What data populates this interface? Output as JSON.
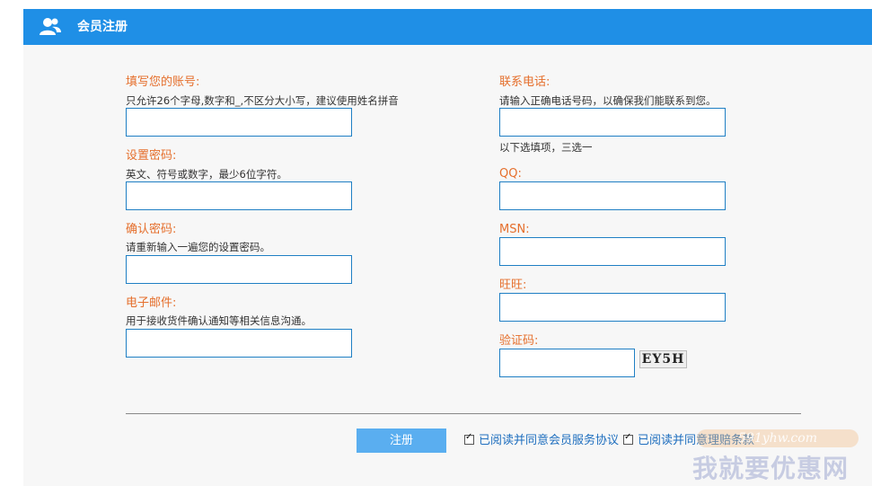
{
  "header": {
    "title": "会员注册",
    "icon": "users-icon"
  },
  "left_fields": [
    {
      "label": "填写您的账号:",
      "hint": "只允许26个字母,数字和_,不区分大小写，建议使用姓名拼音",
      "value": ""
    },
    {
      "label": "设置密码:",
      "hint": "英文、符号或数字，最少6位字符。",
      "value": ""
    },
    {
      "label": "确认密码:",
      "hint": "请重新输入一遍您的设置密码。",
      "value": ""
    },
    {
      "label": "电子邮件:",
      "hint": "用于接收货件确认通知等相关信息沟通。",
      "value": ""
    }
  ],
  "right_fields": {
    "phone": {
      "label": "联系电话:",
      "hint": "请输入正确电话号码，以确保我们能联系到您。",
      "value": ""
    },
    "optional_note": "以下选填项，三选一",
    "qq": {
      "label": "QQ:",
      "value": ""
    },
    "msn": {
      "label": "MSN:",
      "value": ""
    },
    "wangwang": {
      "label": "旺旺:",
      "value": ""
    },
    "captcha": {
      "label": "验证码:",
      "value": "",
      "image_text": "EY5H"
    }
  },
  "footer": {
    "submit_label": "注册",
    "agree_service": "已阅读并同意会员服务协议",
    "agree_claims": "已阅读并同意理赔条款",
    "agree_service_checked": true,
    "agree_claims_checked": true
  },
  "watermark": {
    "top": "591yhw.com",
    "bottom": "我就要优惠网"
  },
  "colors": {
    "header": "#1f8fe6",
    "label": "#e56f2c",
    "link": "#1f6fbf",
    "button": "#5aaef0",
    "input_border": "#1f7fc4"
  }
}
